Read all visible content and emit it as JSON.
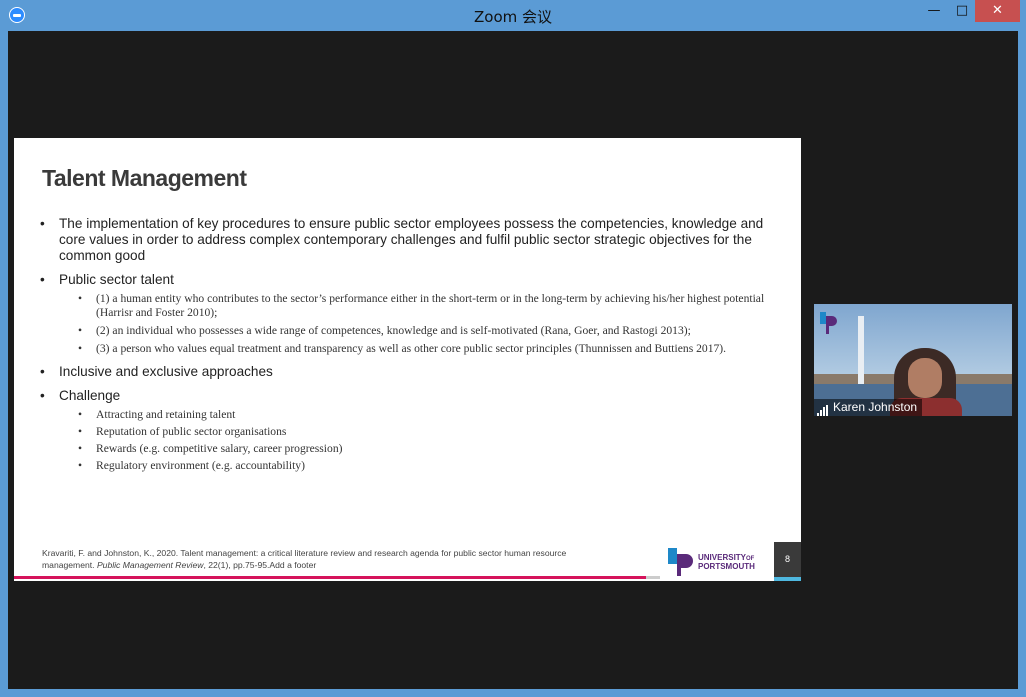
{
  "window": {
    "title": "Zoom 会议",
    "minimize": "—",
    "maximize": "□",
    "close": "✕"
  },
  "slide": {
    "title": "Talent Management",
    "bullets": [
      {
        "text": "The implementation of key procedures to ensure public sector employees possess the competencies, knowledge and core values in order to address complex contemporary challenges and fulfil public sector strategic objectives for the common good",
        "sub": []
      },
      {
        "text": "Public sector talent",
        "sub": [
          "(1) a human entity who contributes to the sector’s performance either in the short-term or in the long-term by achieving his/her highest potential (Harrisr and Foster 2010);",
          "(2) an individual who possesses a wide range of competences, knowledge and is self-motivated (Rana, Goer, and Rastogi 2013);",
          "(3) a person who values equal treatment and transparency as well as other core public sector principles (Thunnissen and Buttiens 2017)."
        ]
      },
      {
        "text": "Inclusive and exclusive approaches",
        "sub": []
      },
      {
        "text": "Challenge",
        "sub": [
          "Attracting and retaining talent",
          "Reputation of public sector organisations",
          "Rewards (e.g. competitive salary, career progression)",
          "Regulatory environment (e.g. accountability)"
        ]
      }
    ],
    "footer_line1": "Kravariti, F. and Johnston, K., 2020. Talent management: a critical literature review and research agenda for public sector human resource",
    "footer_line2_plain": "management. ",
    "footer_line2_italic": "Public Management Review",
    "footer_line2_rest": ", 22(1), pp.75-95.Add a footer",
    "logo_line1": "UNIVERSITY",
    "logo_of": "OF",
    "logo_line2": "PORTSMOUTH",
    "page_number": "8"
  },
  "video": {
    "participant_name": "Karen Johnston",
    "logo_text": "UNIVERSITY OF PORTSMOUTH"
  },
  "colors": {
    "accent_pink": "#d5135b",
    "accent_blue": "#4fb8e0",
    "titlebar": "#5b9bd5"
  },
  "icons": [
    "zoom-app-icon",
    "signal-strength-icon",
    "university-logo-icon"
  ]
}
